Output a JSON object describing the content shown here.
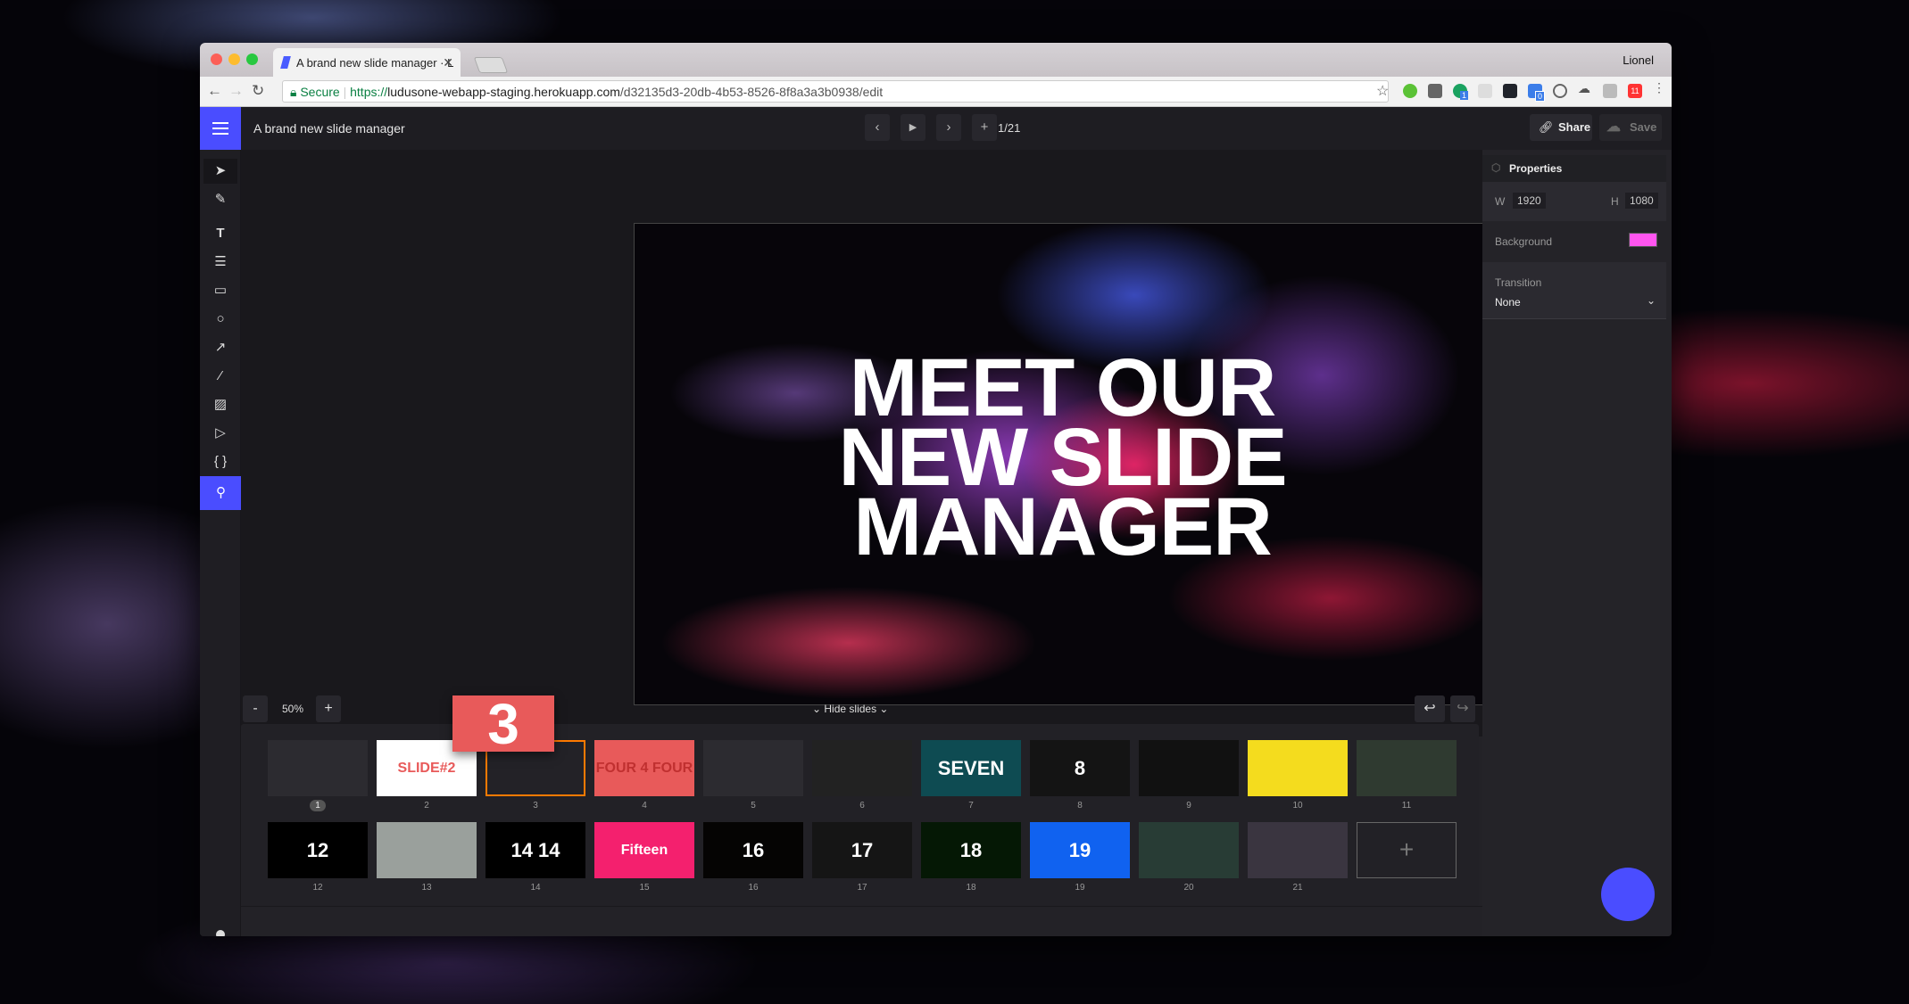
{
  "browser": {
    "tab_title": "A brand new slide manager · L",
    "profile": "Lionel",
    "secure_label": "Secure",
    "url_scheme": "https://",
    "url_host": "ludusone-webapp-staging.herokuapp.com",
    "url_path": "/d32135d3-20db-4b53-8526-8f8a3a3b0938/edit",
    "extension_badges": [
      "1",
      "0",
      "11"
    ]
  },
  "app": {
    "title": "A brand new slide manager",
    "pager": "1/21",
    "share_label": "Share",
    "save_label": "Save",
    "accent": "#4a4dff"
  },
  "tools": [
    "select",
    "pen",
    "text",
    "paragraph",
    "rectangle",
    "ellipse",
    "arrow",
    "line",
    "image",
    "video",
    "code",
    "search"
  ],
  "slide": {
    "headline_lines": [
      "MEET OUR",
      "NEW SLIDE",
      "MANAGER"
    ]
  },
  "bottom_bar": {
    "zoom_out": "-",
    "zoom": "50%",
    "zoom_in": "+",
    "hide_slides": "Hide slides"
  },
  "dragging": {
    "label": "3",
    "color": "#e85a5a"
  },
  "thumbnails": [
    {
      "n": "1",
      "text": "",
      "bg": "#2c2b30",
      "selected": true
    },
    {
      "n": "2",
      "text": "SLIDE#2",
      "bg": "#ffffff"
    },
    {
      "n": "3",
      "text": "",
      "bg": "#232227",
      "current": true
    },
    {
      "n": "4",
      "text": "FOUR 4 FOUR",
      "bg": "#e85a5a"
    },
    {
      "n": "5",
      "text": "",
      "bg": "#2c2b30"
    },
    {
      "n": "6",
      "text": "",
      "bg": "#222"
    },
    {
      "n": "7",
      "text": "SEVEN",
      "bg": "#0e4b52"
    },
    {
      "n": "8",
      "text": "8",
      "bg": "#141414"
    },
    {
      "n": "9",
      "text": "",
      "bg": "#111"
    },
    {
      "n": "10",
      "text": "",
      "bg": "#f4dc1e"
    },
    {
      "n": "11",
      "text": "",
      "bg": "#2f3a30"
    },
    {
      "n": "12",
      "text": "12",
      "bg": "#000"
    },
    {
      "n": "13",
      "text": "",
      "bg": "#9aa09c"
    },
    {
      "n": "14",
      "text": "14 14",
      "bg": "#000"
    },
    {
      "n": "15",
      "text": "Fifteen",
      "bg": "#f4206e"
    },
    {
      "n": "16",
      "text": "16",
      "bg": "#050403"
    },
    {
      "n": "17",
      "text": "17",
      "bg": "#151515"
    },
    {
      "n": "18",
      "text": "18",
      "bg": "#051805"
    },
    {
      "n": "19",
      "text": "19",
      "bg": "#1062f0"
    },
    {
      "n": "20",
      "text": "",
      "bg": "#283c35"
    },
    {
      "n": "21",
      "text": "",
      "bg": "#3a3540"
    }
  ],
  "add_slide": "+",
  "properties": {
    "title": "Properties",
    "w_label": "W",
    "w": "1920",
    "h_label": "H",
    "h": "1080",
    "background_label": "Background",
    "background_color": "#ff55f0",
    "transition_label": "Transition",
    "transition": "None"
  },
  "help": "?"
}
